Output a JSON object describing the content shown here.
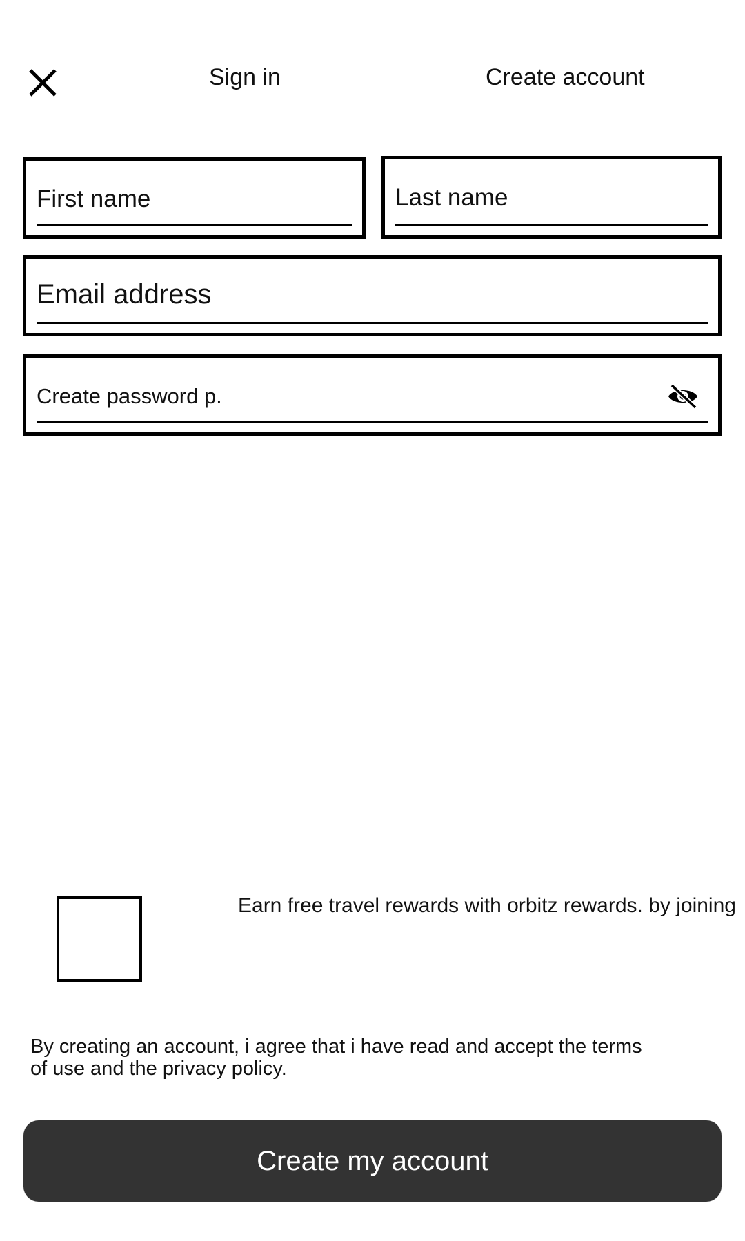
{
  "header": {
    "close_icon": "close-icon",
    "tabs": [
      {
        "label": "Sign in"
      },
      {
        "label": "Create account"
      }
    ]
  },
  "form": {
    "first_name": {
      "placeholder": "First name"
    },
    "last_name": {
      "placeholder": "Last name"
    },
    "email": {
      "placeholder": "Email address"
    },
    "password": {
      "placeholder": "Create password p.",
      "toggle_icon": "eye-slash-icon"
    }
  },
  "rewards": {
    "checked": false,
    "label": "Earn free travel rewards with orbitz rewards. by joining"
  },
  "terms": {
    "text": "By creating an account, i agree that i have read and accept the terms of use and the privacy policy."
  },
  "actions": {
    "create_label": "Create my account",
    "button_color": "#333333"
  }
}
